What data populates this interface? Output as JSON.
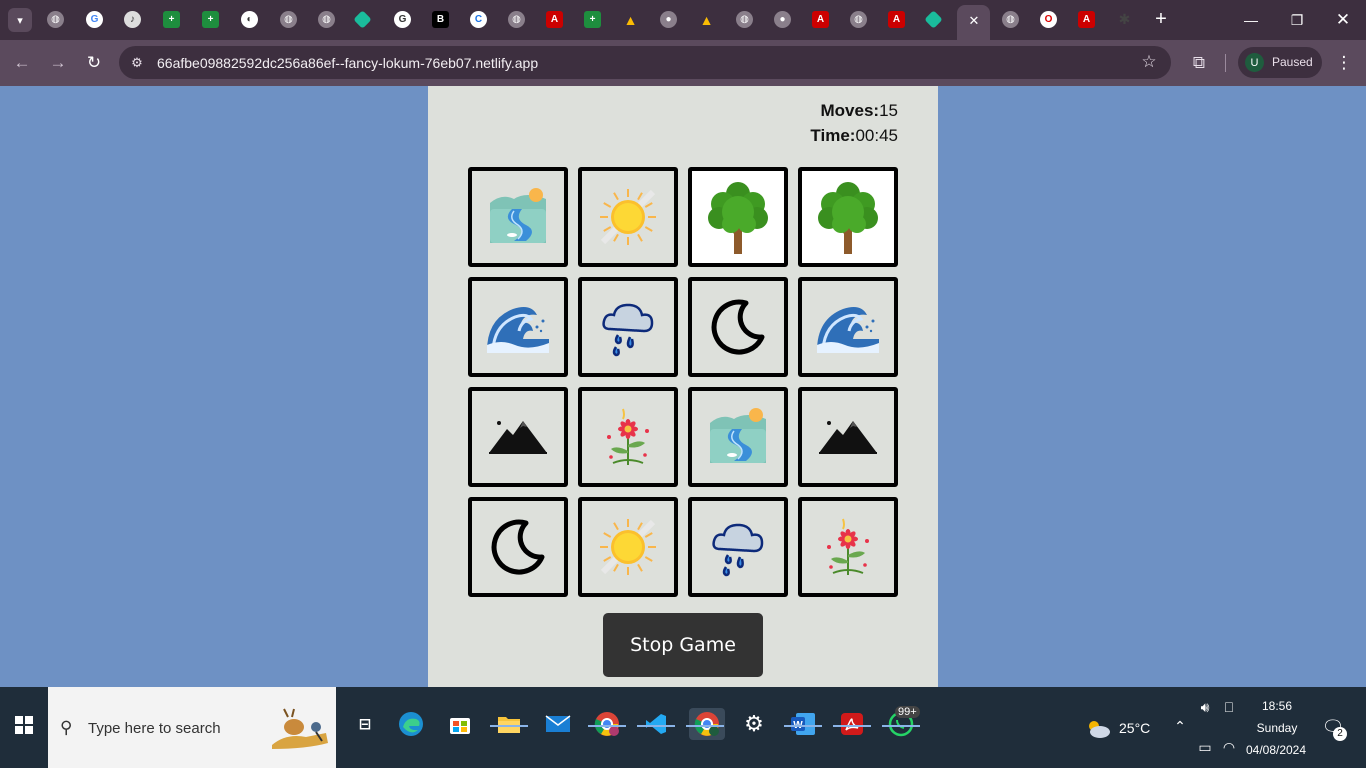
{
  "browser": {
    "url": "66afbe09882592dc256a86ef--fancy-lokum-76eb07.netlify.app",
    "profile_initial": "U",
    "profile_status": "Paused",
    "tab_close_glyph": "✕",
    "new_tab_glyph": "+"
  },
  "game": {
    "moves_label": "Moves:",
    "moves_value": "15",
    "time_label": "Time:",
    "time_value": "00:45",
    "stop_button": "Stop Game",
    "cards": [
      [
        "river-landscape",
        "sun",
        "tree",
        "tree"
      ],
      [
        "wave",
        "rain-cloud",
        "crescent-moon",
        "wave"
      ],
      [
        "mountains",
        "flower",
        "river-landscape",
        "mountains"
      ],
      [
        "crescent-moon",
        "sun",
        "rain-cloud",
        "flower"
      ]
    ],
    "revealed_cards": [
      "tree",
      "tree"
    ]
  },
  "taskbar": {
    "search_placeholder": "Type here to search",
    "weather": "25°C",
    "time": "18:56",
    "day": "Sunday",
    "date": "04/08/2024",
    "notification_count": "2",
    "whatsapp_badge": "99+"
  },
  "colors": {
    "page_background": "#6e91c4",
    "panel_background": "#dde0db",
    "stop_button": "#333333",
    "chrome_tabstrip": "#3d2f3f",
    "chrome_toolbar": "#5b4a5d",
    "taskbar": "#1f2d3a"
  }
}
